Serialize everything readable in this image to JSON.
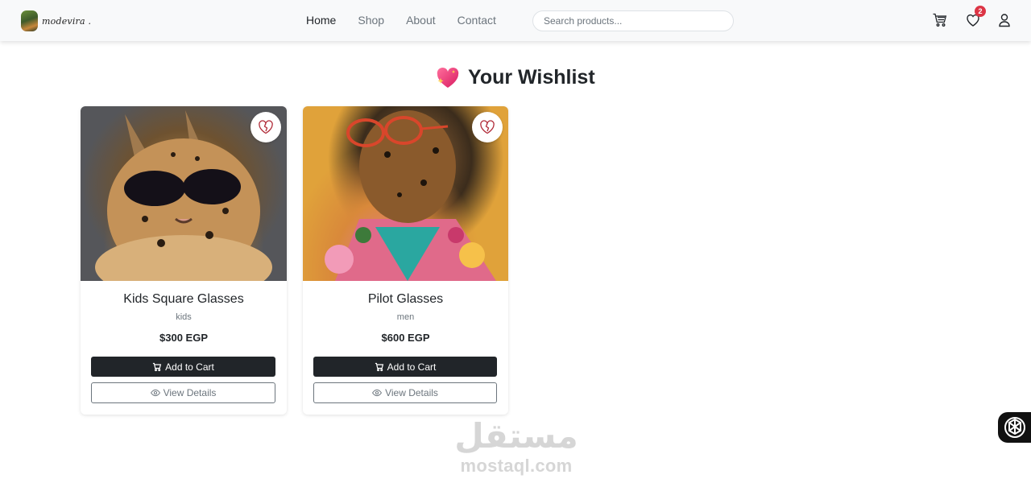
{
  "brand": {
    "name": "modevira .",
    "logo_icon": "brand-logo-image"
  },
  "nav": {
    "links": [
      {
        "label": "Home",
        "active": true
      },
      {
        "label": "Shop",
        "active": false
      },
      {
        "label": "About",
        "active": false
      },
      {
        "label": "Contact",
        "active": false
      }
    ],
    "search_placeholder": "Search products...",
    "icons": [
      "cart-icon",
      "heart-icon",
      "person-icon"
    ],
    "wishlist_count": "2"
  },
  "page": {
    "title": "Your Wishlist",
    "title_icon": "sparkling-heart-icon"
  },
  "products": [
    {
      "name": "Kids Square Glasses",
      "category": "kids",
      "price": "$300 EGP",
      "add_label": "Add to Cart",
      "view_label": "View Details",
      "image_icon": "leopard-sunglasses-photo"
    },
    {
      "name": "Pilot Glasses",
      "category": "men",
      "price": "$600 EGP",
      "add_label": "Add to Cart",
      "view_label": "View Details",
      "image_icon": "leopard-pilot-glasses-photo"
    }
  ],
  "watermark": {
    "arabic": "مستقل",
    "latin": "mostaql.com"
  },
  "colors": {
    "accent": "#212529",
    "badge": "#dc3545",
    "heart": "#e8336d",
    "navbar_bg": "#f8f9fa"
  }
}
